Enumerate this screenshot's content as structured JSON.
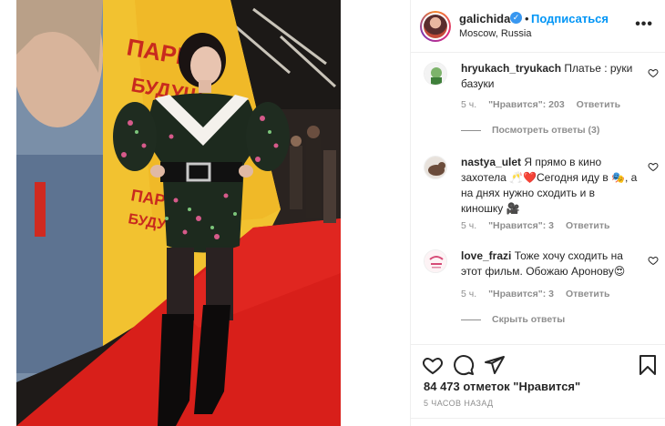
{
  "post": {
    "username": "galichida",
    "follow_label": "Подписаться",
    "dot": "•",
    "location": "Moscow, Russia",
    "more_icon": "more-options-icon"
  },
  "comments": [
    {
      "username": "hryukach_tryukach",
      "text": "Платье : руки базуки",
      "time": "5 ч.",
      "likes": "\"Нравится\": 203",
      "reply": "Ответить",
      "replies_label": "Посмотреть ответы (3)"
    },
    {
      "username": "nastya_ulet",
      "text": "Я прямо в кино захотела 🥂❤️Сегодня иду в 🎭, а на днях нужно сходить и в киношку 🎥",
      "time": "5 ч.",
      "likes": "\"Нравится\": 3",
      "reply": "Ответить"
    },
    {
      "username": "love_frazi",
      "text": "Тоже хочу сходить на этот фильм. Обожаю Аронову😍",
      "time": "5 ч.",
      "likes": "\"Нравится\": 3",
      "reply": "Ответить",
      "replies_label": "Скрыть ответы"
    }
  ],
  "footer": {
    "likes_count": "84 473 отметок \"Нравится\"",
    "time_ago": "5 ЧАСОВ НАЗАД"
  },
  "colors": {
    "accent": "#0095f6",
    "muted": "#8e8e8e",
    "text": "#262626",
    "carpet": "#d81f1a",
    "poster": "#f2c230"
  }
}
